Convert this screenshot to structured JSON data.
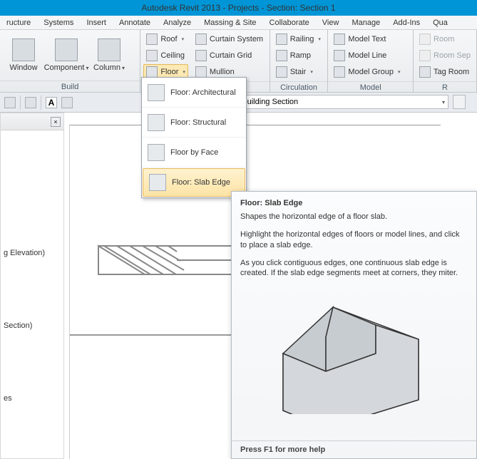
{
  "titlebar": "Autodesk Revit 2013 -     Projects - Section: Section 1",
  "menus": [
    "ructure",
    "Systems",
    "Insert",
    "Annotate",
    "Analyze",
    "Massing & Site",
    "Collaborate",
    "View",
    "Manage",
    "Add-Ins",
    "Qua"
  ],
  "panels": {
    "build": {
      "title": "Build",
      "window": "Window",
      "component": "Component",
      "column": "Column",
      "roof": "Roof",
      "ceiling": "Ceiling",
      "floor": "Floor",
      "curtain_system": "Curtain System",
      "curtain_grid": "Curtain Grid",
      "mullion": "Mullion"
    },
    "circulation": {
      "title": "Circulation",
      "railing": "Railing",
      "ramp": "Ramp",
      "stair": "Stair"
    },
    "model": {
      "title": "Model",
      "model_text": "Model Text",
      "model_line": "Model Line",
      "model_group": "Model Group"
    },
    "room": {
      "title": "R",
      "room": "Room",
      "room_sep": "Room Sep",
      "tag_room": "Tag Room"
    }
  },
  "selector": {
    "value": "n : Building Section"
  },
  "tree": {
    "item1": "g Elevation)",
    "item2": "Section)",
    "item3": "es"
  },
  "dropdown": {
    "arch": "Floor: Architectural",
    "struct": "Floor: Structural",
    "face": "Floor by Face",
    "slab": "Floor: Slab Edge"
  },
  "tooltip": {
    "title": "Floor: Slab Edge",
    "p1": "Shapes the horizontal edge of a floor slab.",
    "p2": "Highlight the horizontal edges of floors or model lines, and click to place a slab edge.",
    "p3": "As you click contiguous edges, one continuous slab edge is created. If the slab edge segments meet at corners, they miter.",
    "footer": "Press F1 for more help"
  }
}
